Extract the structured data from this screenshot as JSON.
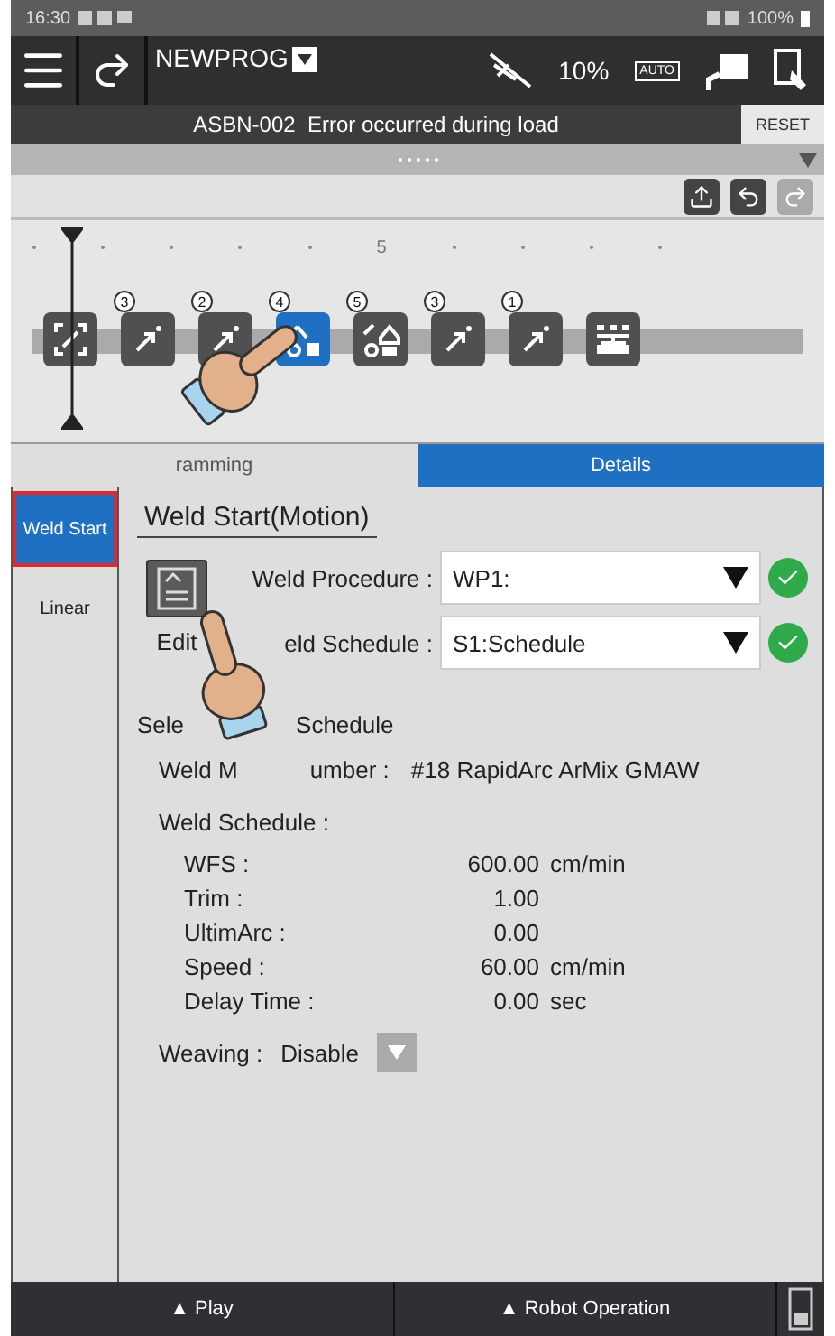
{
  "status_bar": {
    "time": "16:30",
    "battery": "100%"
  },
  "header": {
    "program": "NEWPROG",
    "speed": "10%",
    "mode": "AUTO"
  },
  "alarm": {
    "message": "ASBN-002  Error occurred during load",
    "reset": "RESET"
  },
  "timeline": {
    "marker": "5",
    "steps": [
      {
        "kind": "frame",
        "selected": false
      },
      {
        "kind": "move",
        "badge": "3",
        "selected": false
      },
      {
        "kind": "move",
        "badge": "2",
        "selected": false
      },
      {
        "kind": "weld_start",
        "badge": "4",
        "selected": true
      },
      {
        "kind": "weld_end",
        "badge": "5",
        "selected": false
      },
      {
        "kind": "move",
        "badge": "3",
        "selected": false
      },
      {
        "kind": "move",
        "badge": "1",
        "selected": false
      },
      {
        "kind": "branch",
        "selected": false
      }
    ]
  },
  "tabs": [
    {
      "label": "ramming",
      "selected": false
    },
    {
      "label": "Details",
      "selected": true
    }
  ],
  "side_tabs": [
    {
      "label": "Weld Start",
      "selected": true
    },
    {
      "label": "Linear",
      "selected": false
    }
  ],
  "details": {
    "title": "Weld Start(Motion)",
    "edit_label": "Edit",
    "fields": [
      {
        "label": "Weld Procedure :",
        "value": "WP1:",
        "valid": true
      },
      {
        "label": "eld Schedule :",
        "value": "S1:Schedule",
        "valid": true
      }
    ],
    "selected_heading": [
      "Sele",
      "Schedule"
    ],
    "mode_number": {
      "label_parts": [
        "Weld M",
        "umber :"
      ],
      "value": "#18 RapidArc ArMix GMAW"
    },
    "schedule_heading": "Weld Schedule :",
    "params": [
      {
        "label": "WFS :",
        "value": "600.00",
        "unit": "cm/min"
      },
      {
        "label": "Trim :",
        "value": "1.00"
      },
      {
        "label": "UltimArc :",
        "value": "0.00"
      },
      {
        "label": "Speed :",
        "value": "60.00",
        "unit": "cm/min"
      },
      {
        "label": "Delay Time :",
        "value": "0.00",
        "unit": "sec"
      }
    ],
    "weaving": {
      "label": "Weaving :",
      "value": "Disable"
    }
  },
  "footer": {
    "buttons": [
      "▲ Play",
      "▲ Robot Operation"
    ]
  }
}
